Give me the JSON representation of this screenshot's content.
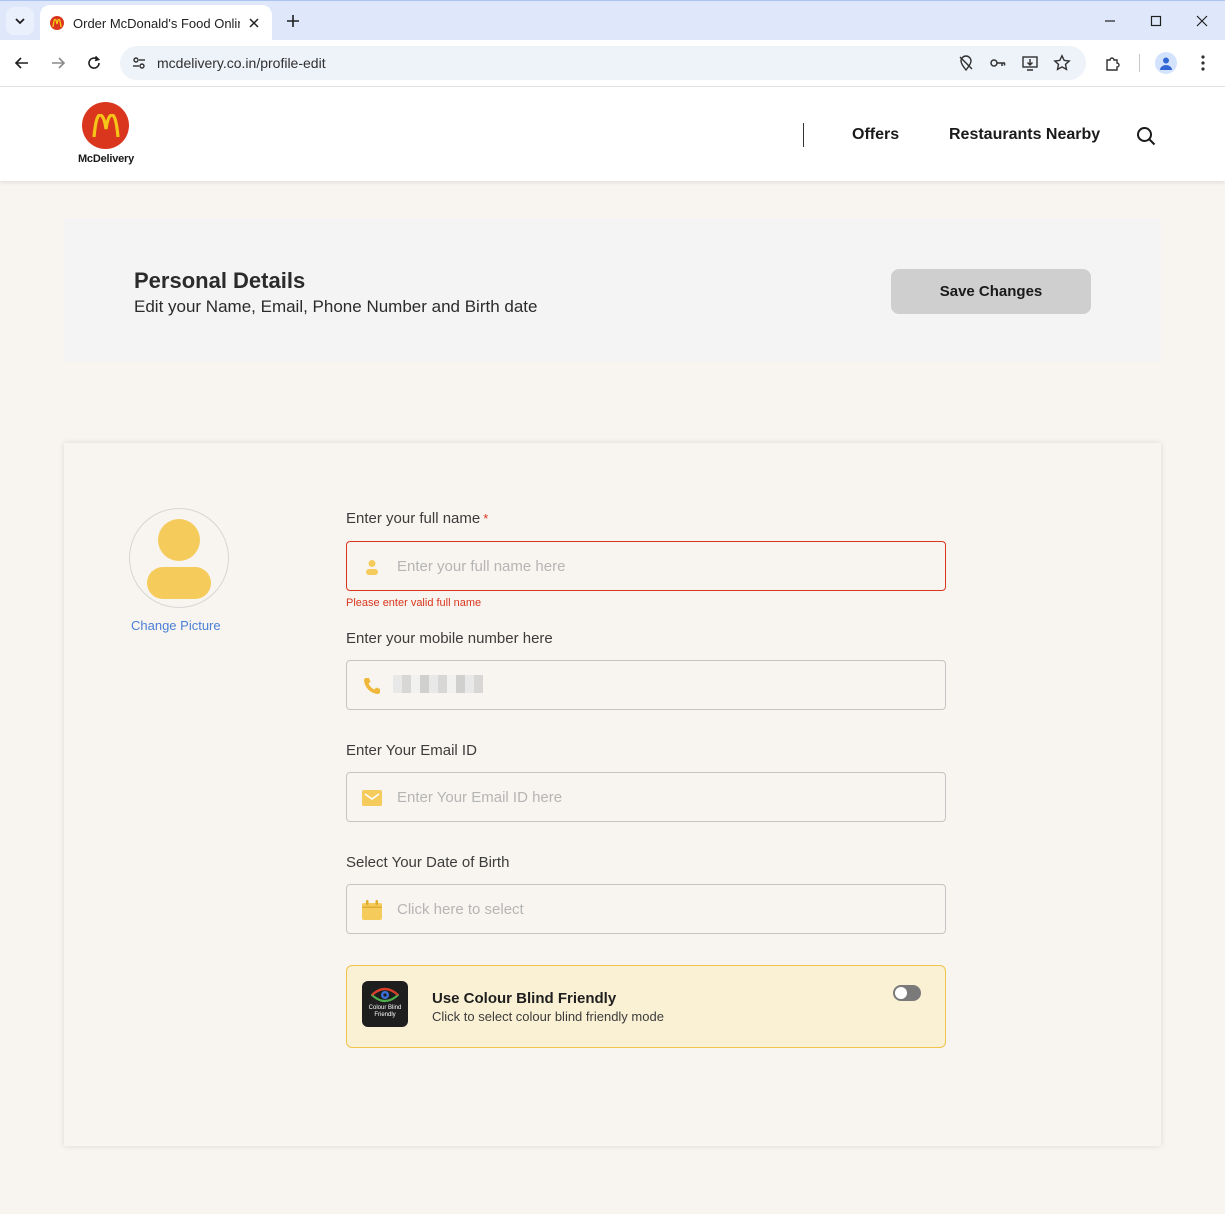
{
  "browser": {
    "tab_title": "Order McDonald's Food Online",
    "url": "mcdelivery.co.in/profile-edit"
  },
  "header": {
    "logo_text": "McDelivery",
    "nav": {
      "offers": "Offers",
      "restaurants_nearby": "Restaurants Nearby"
    }
  },
  "details": {
    "title": "Personal Details",
    "subtitle": "Edit your Name, Email, Phone Number and Birth date",
    "save_label": "Save Changes"
  },
  "profile": {
    "change_picture": "Change Picture"
  },
  "form": {
    "name": {
      "label": "Enter your full name",
      "required_mark": "*",
      "placeholder": "Enter your full name here",
      "error": "Please enter valid full name"
    },
    "mobile": {
      "label": "Enter your mobile number here"
    },
    "email": {
      "label": "Enter Your Email ID",
      "placeholder": "Enter Your Email ID here"
    },
    "dob": {
      "label": "Select Your Date of Birth",
      "placeholder": "Click here to select"
    },
    "colour_blind": {
      "badge_text": "Colour Blind Friendly",
      "title": "Use Colour Blind Friendly",
      "subtitle": "Click to select colour blind friendly mode",
      "enabled": false
    }
  },
  "colors": {
    "brand_red": "#d9361d",
    "accent_yellow": "#f5cb5c",
    "link_blue": "#4a7fd6"
  }
}
